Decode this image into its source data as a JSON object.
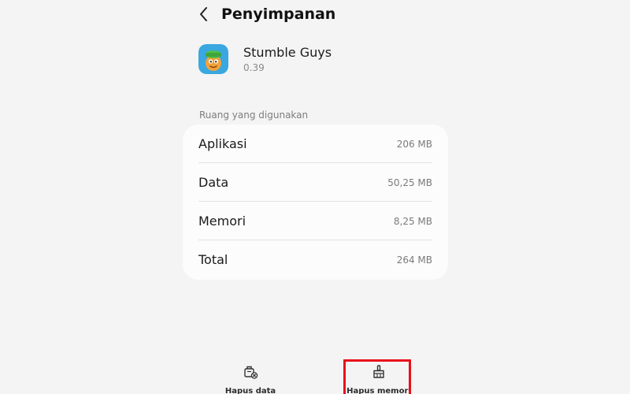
{
  "header": {
    "title": "Penyimpanan",
    "back_icon": "chevron-left-icon"
  },
  "app": {
    "name": "Stumble Guys",
    "version": "0.39",
    "icon": "stumble-guys-app-icon"
  },
  "storage": {
    "section_title": "Ruang yang digunakan",
    "rows": [
      {
        "label": "Aplikasi",
        "value": "206 MB"
      },
      {
        "label": "Data",
        "value": "50,25 MB"
      },
      {
        "label": "Memori",
        "value": "8,25 MB"
      },
      {
        "label": "Total",
        "value": "264 MB"
      }
    ]
  },
  "actions": {
    "clear_data_label": "Hapus data",
    "clear_data_icon": "clear-data-icon",
    "clear_cache_label": "Hapus memori",
    "clear_cache_icon": "broom-icon"
  },
  "colors": {
    "background": "#f4f4f4",
    "card": "#fcfcfc",
    "highlight": "#e8101a"
  }
}
